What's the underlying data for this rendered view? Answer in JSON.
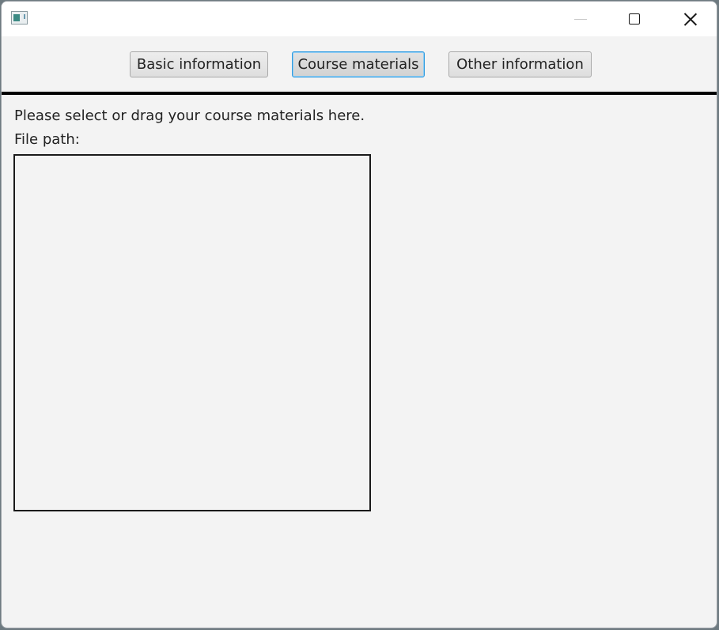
{
  "window": {
    "title": ""
  },
  "tabs": [
    {
      "label": "Basic information",
      "selected": false
    },
    {
      "label": "Course materials",
      "selected": true
    },
    {
      "label": "Other information",
      "selected": false
    }
  ],
  "content": {
    "instruction": "Please select or drag your course materials here.",
    "file_path_label": "File path:",
    "file_path_value": ""
  },
  "icons": {
    "app": "app-icon",
    "minimize": "minimize-icon",
    "maximize": "maximize-icon",
    "close": "close-icon"
  },
  "colors": {
    "focus_accent": "#2f9be0",
    "window_bg": "#f3f3f3",
    "divider": "#000000"
  }
}
